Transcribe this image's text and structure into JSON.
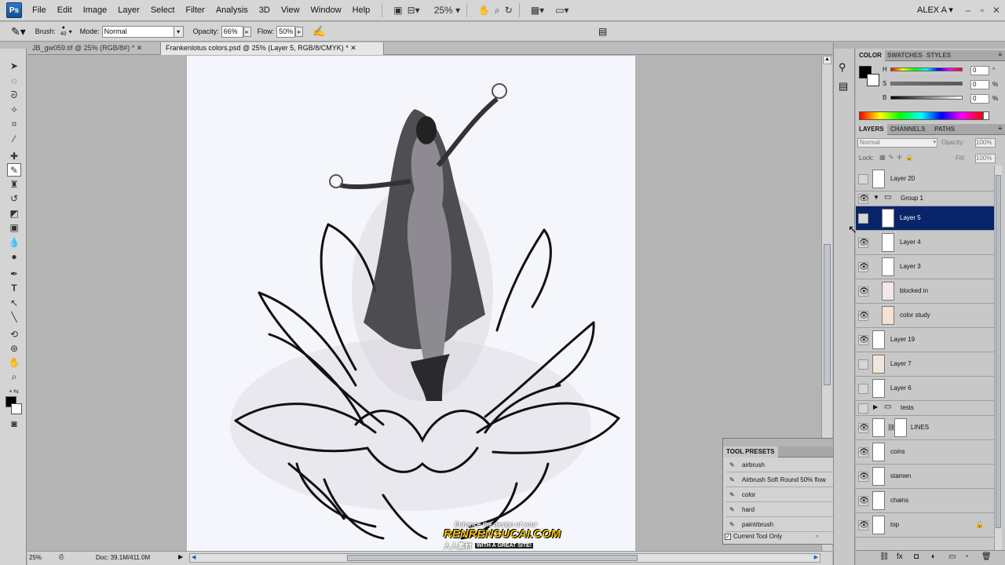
{
  "menubar": {
    "logo": "Ps",
    "items": [
      "File",
      "Edit",
      "Image",
      "Layer",
      "Select",
      "Filter",
      "Analysis",
      "3D",
      "View",
      "Window",
      "Help"
    ],
    "zoom": "25%",
    "user": "ALEX A"
  },
  "options": {
    "brush_label": "Brush:",
    "brush_size": "40",
    "mode_label": "Mode:",
    "mode_value": "Normal",
    "opacity_label": "Opacity:",
    "opacity_value": "66%",
    "flow_label": "Flow:",
    "flow_value": "50%"
  },
  "tabs": [
    {
      "label": "JB_gw059.tif @ 25% (RGB/8#) *"
    },
    {
      "label": "Frankenlotus colors.psd @ 25% (Layer 5, RGB/8/CMYK) *"
    }
  ],
  "status": {
    "zoom": "25%",
    "doc": "Doc: 39.1M/411.0M"
  },
  "color_panel": {
    "tabs": [
      "COLOR",
      "SWATCHES",
      "STYLES"
    ],
    "h": "0",
    "s": "0",
    "b": "0",
    "h_label": "H",
    "s_label": "S",
    "b_label": "B",
    "h_unit": "°",
    "s_unit": "%",
    "b_unit": "%"
  },
  "layers_panel": {
    "tabs": [
      "LAYERS",
      "CHANNELS",
      "PATHS"
    ],
    "blend": "Normal",
    "opacity_label": "Opacity:",
    "opacity": "100%",
    "lock_label": "Lock:",
    "fill_label": "Fill:",
    "fill": "100%",
    "layers": [
      {
        "name": "Layer 20"
      },
      {
        "name": "Group 1"
      },
      {
        "name": "Layer 5"
      },
      {
        "name": "Layer 4"
      },
      {
        "name": "Layer 3"
      },
      {
        "name": "blocked in"
      },
      {
        "name": "color study"
      },
      {
        "name": "Layer 19"
      },
      {
        "name": "Layer 7"
      },
      {
        "name": "Layer 6"
      },
      {
        "name": "tests"
      },
      {
        "name": "LINES"
      },
      {
        "name": "coins"
      },
      {
        "name": "stamen"
      },
      {
        "name": "chains"
      },
      {
        "name": "top"
      }
    ]
  },
  "tool_presets": {
    "title": "TOOL PRESETS",
    "items": [
      "airbrush",
      "Airbrush Soft Round 50% flow",
      "color",
      "hard",
      "paintrbrush"
    ],
    "current_only": "Current Tool Only"
  },
  "watermark": {
    "tagline": "Enhance the design of your",
    "brand": "RENRENSUCAI.COM",
    "sub": "WITH A GREAT SITE!",
    "cn": "人人素材"
  },
  "colors": {
    "accent": "#0a246a",
    "fg": "#000000",
    "bg": "#ffffff"
  }
}
